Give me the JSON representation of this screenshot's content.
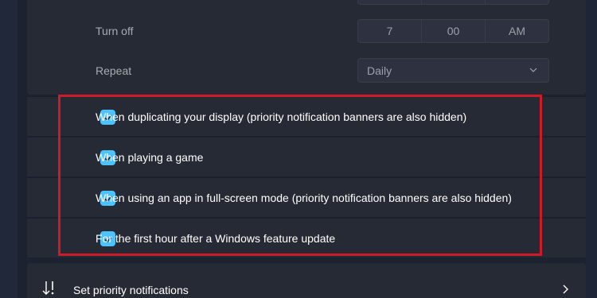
{
  "schedule": {
    "turn_off_label": "Turn off",
    "turn_off_time": {
      "hour": "7",
      "minute": "00",
      "period": "AM"
    },
    "repeat_label": "Repeat",
    "repeat_value": "Daily"
  },
  "conditions": [
    {
      "label": "When duplicating your display (priority notification banners are also hidden)",
      "checked": true
    },
    {
      "label": "When playing a game",
      "checked": true
    },
    {
      "label": "When using an app in full-screen mode (priority notification banners are also hidden)",
      "checked": true
    },
    {
      "label": "For the first hour after a Windows feature update",
      "checked": true
    }
  ],
  "priority": {
    "label": "Set priority notifications",
    "icon": "priority-notifications-icon"
  },
  "colors": {
    "accent": "#4cc2ff",
    "highlight": "#d11a28",
    "background": "#1c2230",
    "card": "#262a35"
  }
}
